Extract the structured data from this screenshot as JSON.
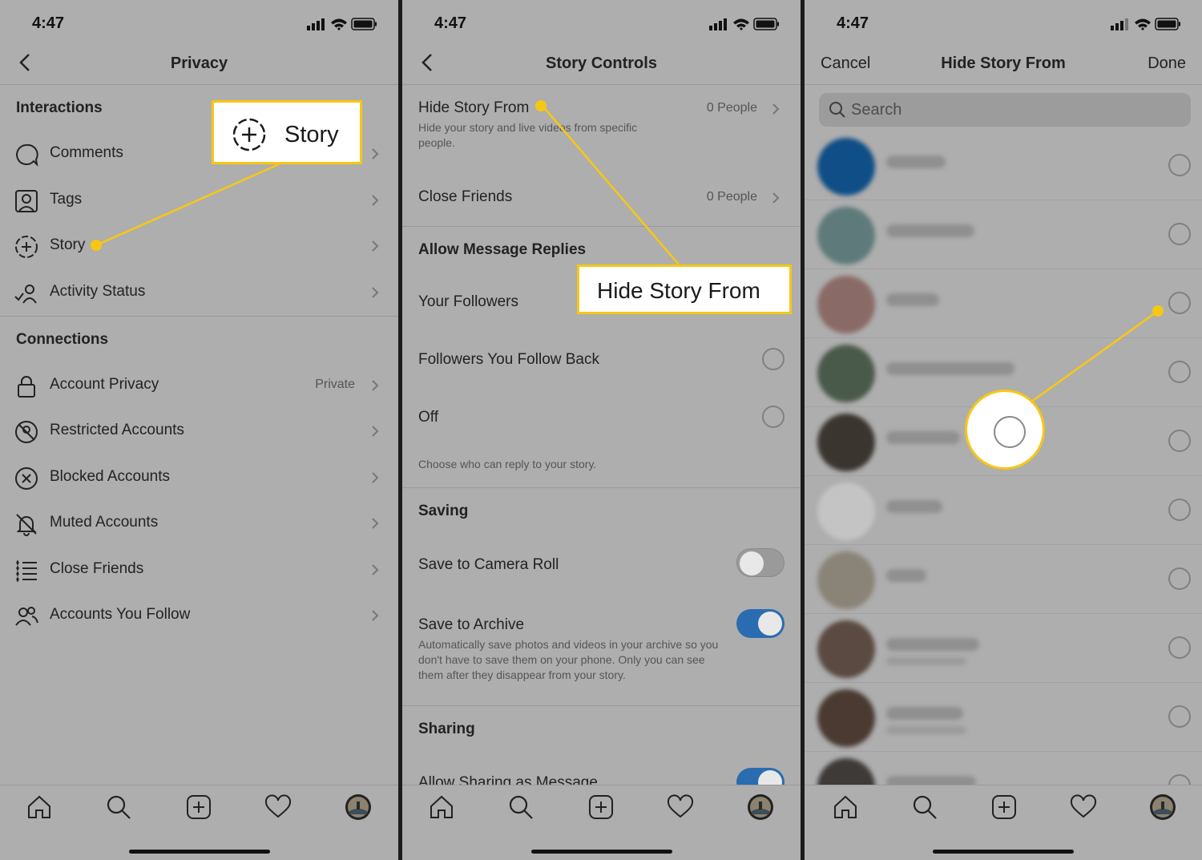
{
  "status": {
    "time": "4:47"
  },
  "screen1": {
    "title": "Privacy",
    "interactions_header": "Interactions",
    "interactions": [
      {
        "label": "Comments",
        "icon": "comment-icon"
      },
      {
        "label": "Tags",
        "icon": "tag-person-icon"
      },
      {
        "label": "Story",
        "icon": "story-plus-icon"
      },
      {
        "label": "Activity Status",
        "icon": "activity-status-icon"
      }
    ],
    "connections_header": "Connections",
    "connections": [
      {
        "label": "Account Privacy",
        "value": "Private",
        "icon": "lock-icon"
      },
      {
        "label": "Restricted Accounts",
        "icon": "restricted-icon"
      },
      {
        "label": "Blocked Accounts",
        "icon": "blocked-icon"
      },
      {
        "label": "Muted Accounts",
        "icon": "muted-bell-icon"
      },
      {
        "label": "Close Friends",
        "icon": "close-friends-list-icon"
      },
      {
        "label": "Accounts You Follow",
        "icon": "people-icon"
      }
    ],
    "callout": "Story"
  },
  "screen2": {
    "title": "Story Controls",
    "hide_story_from": {
      "label": "Hide Story From",
      "value": "0 People",
      "desc": "Hide your story and live videos from specific people."
    },
    "close_friends": {
      "label": "Close Friends",
      "value": "0 People"
    },
    "replies_header": "Allow Message Replies",
    "replies": [
      "Your Followers",
      "Followers You Follow Back",
      "Off"
    ],
    "replies_note": "Choose who can reply to your story.",
    "saving_header": "Saving",
    "save_camera_roll": {
      "label": "Save to Camera Roll",
      "on": false
    },
    "save_archive": {
      "label": "Save to Archive",
      "on": true,
      "desc": "Automatically save photos and videos in your archive so you don't have to save them on your phone. Only you can see them after they disappear from your story."
    },
    "sharing_header": "Sharing",
    "allow_sharing": {
      "label": "Allow Sharing as Message",
      "on": true
    },
    "callout": "Hide Story From"
  },
  "screen3": {
    "title": "Hide Story From",
    "cancel": "Cancel",
    "done": "Done",
    "search_placeholder": "Search",
    "people_count": 10
  },
  "colors": {
    "accent": "#f7c715",
    "toggle_on": "#2a6cb0",
    "background": "#aeaeae"
  }
}
